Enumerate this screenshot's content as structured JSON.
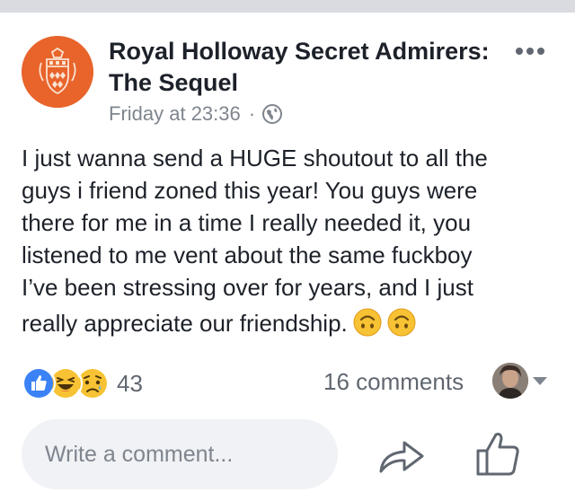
{
  "post": {
    "author": "Royal Holloway Secret Admirers: The Sequel",
    "timestamp": "Friday at 23:36",
    "separator": "·",
    "lines": [
      "I just wanna send a HUGE shoutout to all the",
      "guys i friend zoned this year! You guys were",
      "there for me in a time I really needed it, you",
      "listened to me vent about the same fuckboy",
      "I’ve been stressing over for years, and I just",
      "really appreciate our friendship."
    ],
    "emoji_icons": [
      "upside-down-face",
      "upside-down-face"
    ]
  },
  "reactions": {
    "icons": [
      "like",
      "haha",
      "sad"
    ],
    "count": "43",
    "colors": {
      "like": "#3b82f6",
      "emoji": "#f7c233"
    }
  },
  "comments": {
    "count_label": "16 comments"
  },
  "comment_input": {
    "placeholder": "Write a comment..."
  },
  "actions": {
    "share_icon": "share",
    "like_icon": "thumbs-up"
  },
  "colors": {
    "page_avatar": "#e8642b",
    "meta_text": "#7f858e",
    "action_icon": "#606770"
  }
}
